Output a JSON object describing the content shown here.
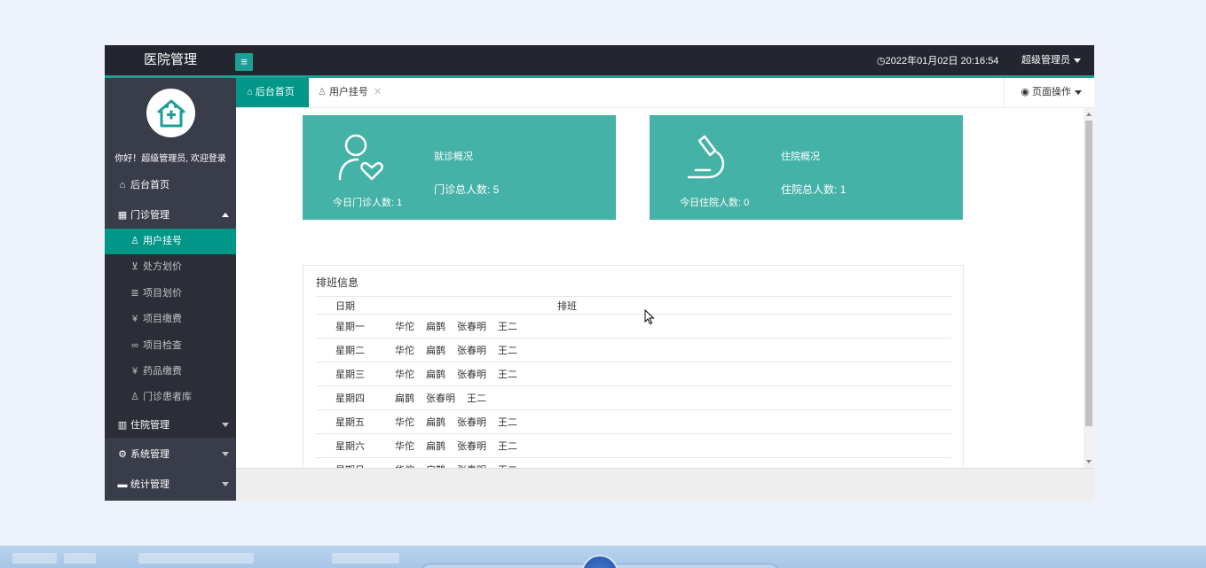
{
  "header": {
    "brand": "医院管理",
    "menu_toggle_icon": "hamburger-icon",
    "datetime": "2022年01月02日 20:16:54",
    "user": "超级管理员"
  },
  "sidebar": {
    "greeting": "你好！超级管理员, 欢迎登录",
    "items": [
      {
        "label": "后台首页",
        "icon": "home-icon"
      },
      {
        "label": "门诊管理",
        "icon": "grid-icon",
        "expanded": true
      },
      {
        "label": "住院管理",
        "icon": "building-icon"
      },
      {
        "label": "系统管理",
        "icon": "gear-icon"
      },
      {
        "label": "统计管理",
        "icon": "chart-icon"
      }
    ],
    "sub_items": [
      {
        "label": "用户挂号",
        "icon": "user-icon",
        "active": true
      },
      {
        "label": "处方划价",
        "icon": "cart-icon"
      },
      {
        "label": "项目划价",
        "icon": "list-icon"
      },
      {
        "label": "项目缴费",
        "icon": "yen-icon"
      },
      {
        "label": "项目检查",
        "icon": "link-icon"
      },
      {
        "label": "药品缴费",
        "icon": "yen-icon"
      },
      {
        "label": "门诊患者库",
        "icon": "person-icon"
      }
    ]
  },
  "tabs": [
    {
      "label": "后台首页",
      "icon": "home-icon",
      "active": true
    },
    {
      "label": "用户挂号",
      "icon": "user-icon",
      "closable": true
    }
  ],
  "page_ops": "页面操作",
  "cards": {
    "clinic": {
      "title": "就诊概况",
      "today": "今日门诊人数: 1",
      "total": "门诊总人数: 5",
      "icon": "user-heart-icon"
    },
    "inpatient": {
      "title": "住院概况",
      "today": "今日住院人数: 0",
      "total": "住院总人数: 1",
      "icon": "microscope-icon"
    }
  },
  "schedule": {
    "title": "排班信息",
    "columns": [
      "日期",
      "排班"
    ],
    "rows": [
      {
        "day": "星期一",
        "doctors": [
          "华佗",
          "扁鹊",
          "张春明",
          "王二"
        ]
      },
      {
        "day": "星期二",
        "doctors": [
          "华佗",
          "扁鹊",
          "张春明",
          "王二"
        ]
      },
      {
        "day": "星期三",
        "doctors": [
          "华佗",
          "扁鹊",
          "张春明",
          "王二"
        ]
      },
      {
        "day": "星期四",
        "doctors": [
          "扁鹊",
          "张春明",
          "王二"
        ]
      },
      {
        "day": "星期五",
        "doctors": [
          "华佗",
          "扁鹊",
          "张春明",
          "王二"
        ]
      },
      {
        "day": "星期六",
        "doctors": [
          "华佗",
          "扁鹊",
          "张春明",
          "王二"
        ]
      },
      {
        "day": "星期日",
        "doctors": [
          "华佗",
          "扁鹊",
          "张春明",
          "王二"
        ]
      }
    ]
  },
  "colors": {
    "header_bg": "#23262e",
    "sidebar_bg": "#393d49",
    "accent": "#009688",
    "card_bg": "#45b2a8"
  }
}
